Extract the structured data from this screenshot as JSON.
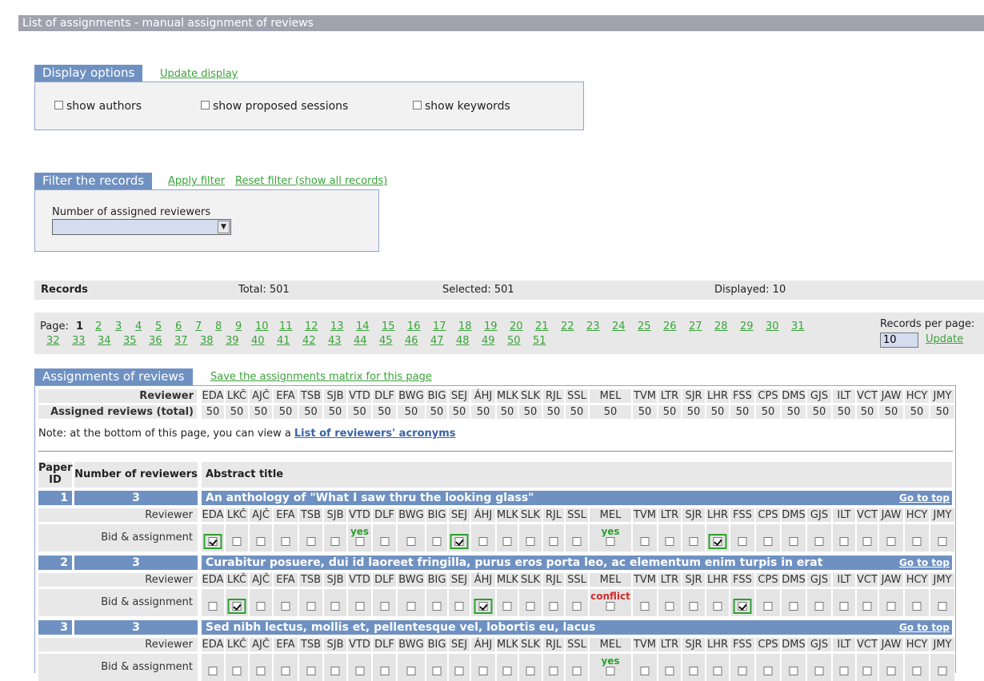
{
  "page": {
    "title": "List of assignments - manual assignment of reviews"
  },
  "display_options": {
    "heading": "Display options",
    "update_link": "Update display",
    "options": [
      {
        "label": "show authors",
        "checked": false
      },
      {
        "label": "show proposed sessions",
        "checked": false
      },
      {
        "label": "show keywords",
        "checked": false
      }
    ]
  },
  "filter": {
    "heading": "Filter the records",
    "apply_link": "Apply filter",
    "reset_link": "Reset filter (show all records)",
    "field_label": "Number of assigned reviewers",
    "field_value": ""
  },
  "records": {
    "label": "Records",
    "total": "Total: 501",
    "selected": "Selected: 501",
    "displayed": "Displayed: 10"
  },
  "pager": {
    "label": "Page:",
    "current": "1",
    "pages_row1": [
      "2",
      "3",
      "4",
      "5",
      "6",
      "7",
      "8",
      "9",
      "10",
      "11",
      "12",
      "13",
      "14",
      "15",
      "16",
      "17",
      "18",
      "19",
      "20",
      "21",
      "22",
      "23",
      "24",
      "25",
      "26",
      "27",
      "28",
      "29",
      "30",
      "31"
    ],
    "pages_row2": [
      "32",
      "33",
      "34",
      "35",
      "36",
      "37",
      "38",
      "39",
      "40",
      "41",
      "42",
      "43",
      "44",
      "45",
      "46",
      "47",
      "48",
      "49",
      "50",
      "51"
    ],
    "records_per_page_label": "Records per page:",
    "records_per_page_value": "10",
    "update_link": "Update"
  },
  "assignments": {
    "heading": "Assignments of reviews",
    "save_link": "Save the assignments matrix for this page",
    "reviewer_label": "Reviewer",
    "assigned_total_label": "Assigned reviews (total)",
    "reviewers": [
      "EDA",
      "LKČ",
      "AJČ",
      "EFA",
      "TSB",
      "SJB",
      "VTD",
      "DLF",
      "BWG",
      "BIG",
      "SEJ",
      "ÁHJ",
      "MLK",
      "SLK",
      "RJL",
      "SSL",
      "MEL",
      "TVM",
      "LTR",
      "SJR",
      "LHR",
      "FSS",
      "CPS",
      "DMS",
      "GJS",
      "ILT",
      "VCT",
      "JAW",
      "HCY",
      "JMY"
    ],
    "totals": [
      "50",
      "50",
      "50",
      "50",
      "50",
      "50",
      "50",
      "50",
      "50",
      "50",
      "50",
      "50",
      "50",
      "50",
      "50",
      "50",
      "50",
      "50",
      "50",
      "50",
      "50",
      "50",
      "50",
      "50",
      "50",
      "50",
      "50",
      "50",
      "50",
      "50"
    ],
    "note_prefix": "Note: at the bottom of this page, you can view a",
    "note_link": "List of reviewers' acronyms",
    "col_paper_id": "Paper ID",
    "col_num_reviewers": "Number of reviewers",
    "col_abstract_title": "Abstract title",
    "row_reviewer_label": "Reviewer",
    "row_bid_label": "Bid & assignment",
    "goto_top": "Go to top",
    "papers": [
      {
        "id": "1",
        "num": "3",
        "title": "An anthology of \"What I saw thru the looking glass\"",
        "bids": {
          "6": "yes",
          "16": "yes"
        },
        "assigned": [
          0,
          10,
          20
        ]
      },
      {
        "id": "2",
        "num": "3",
        "title": "Curabitur posuere, dui id laoreet fringilla, purus eros porta leo, ac elementum enim turpis in erat",
        "bids": {
          "16": "conflict"
        },
        "assigned": [
          1,
          11,
          21
        ]
      },
      {
        "id": "3",
        "num": "3",
        "title": "Sed nibh lectus, mollis et, pellentesque vel, lobortis eu, lacus",
        "bids": {
          "16": "yes"
        },
        "assigned": []
      }
    ]
  }
}
